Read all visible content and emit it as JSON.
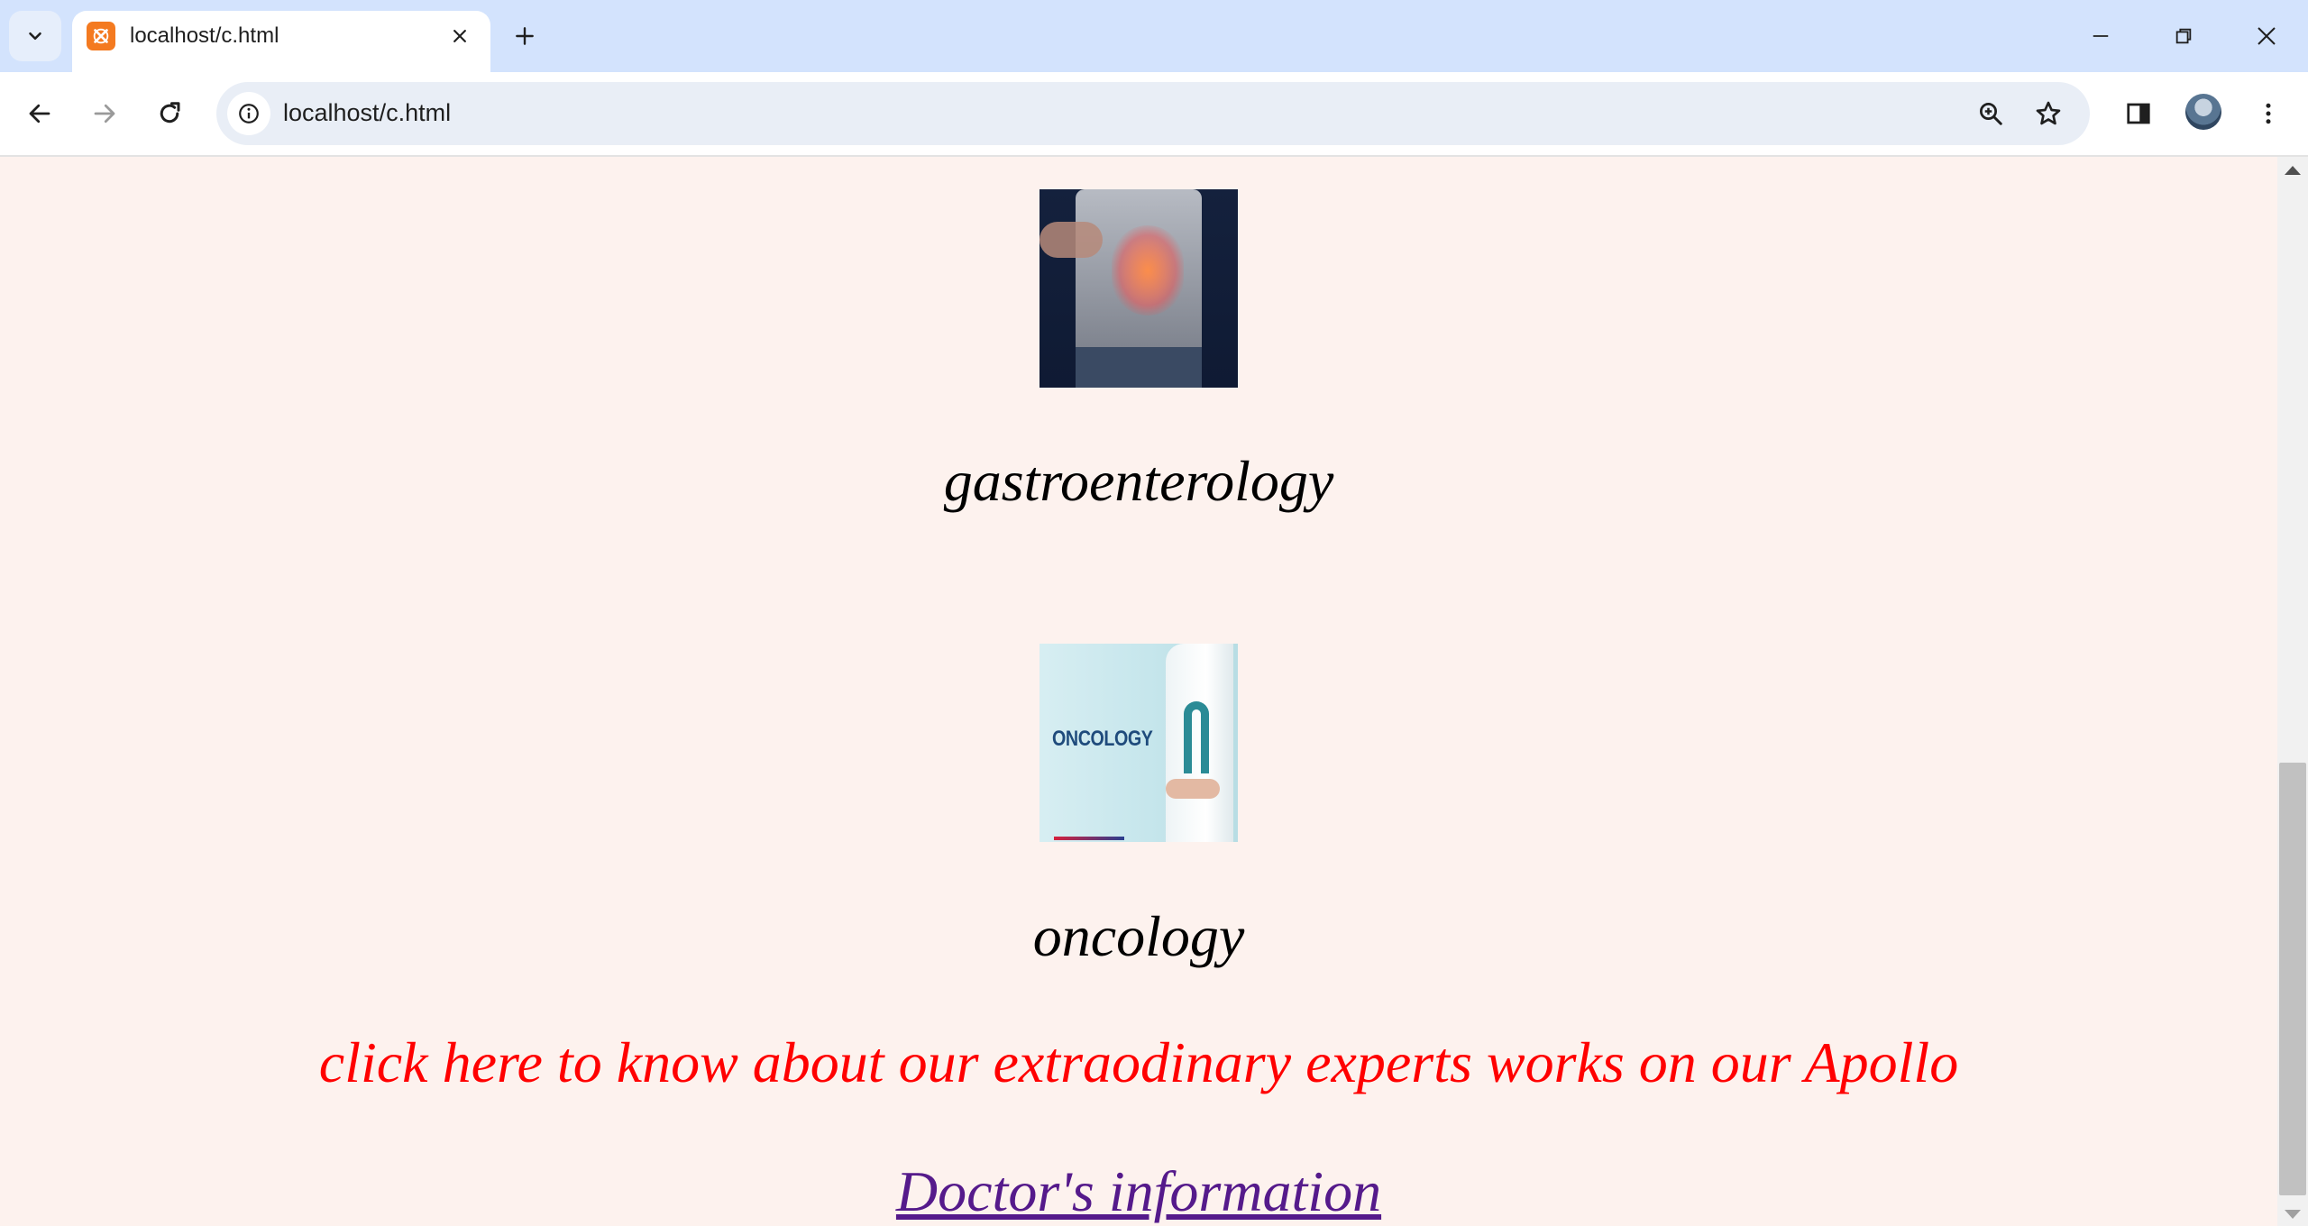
{
  "browser": {
    "tab": {
      "title": "localhost/c.html"
    },
    "address_bar": {
      "url": "localhost/c.html"
    }
  },
  "page": {
    "sections": [
      {
        "label": "gastroenterology"
      },
      {
        "label": "oncology",
        "image_text": "ONCOLOGY"
      }
    ],
    "cta_text": "click here to know about our extraodinary experts works on our Apollo",
    "doctor_link": "Doctor's information"
  },
  "colors": {
    "tab_strip": "#d3e3fd",
    "page_background": "#fdf2ee",
    "cta": "#ff0000",
    "visited_link": "#551a8b"
  }
}
